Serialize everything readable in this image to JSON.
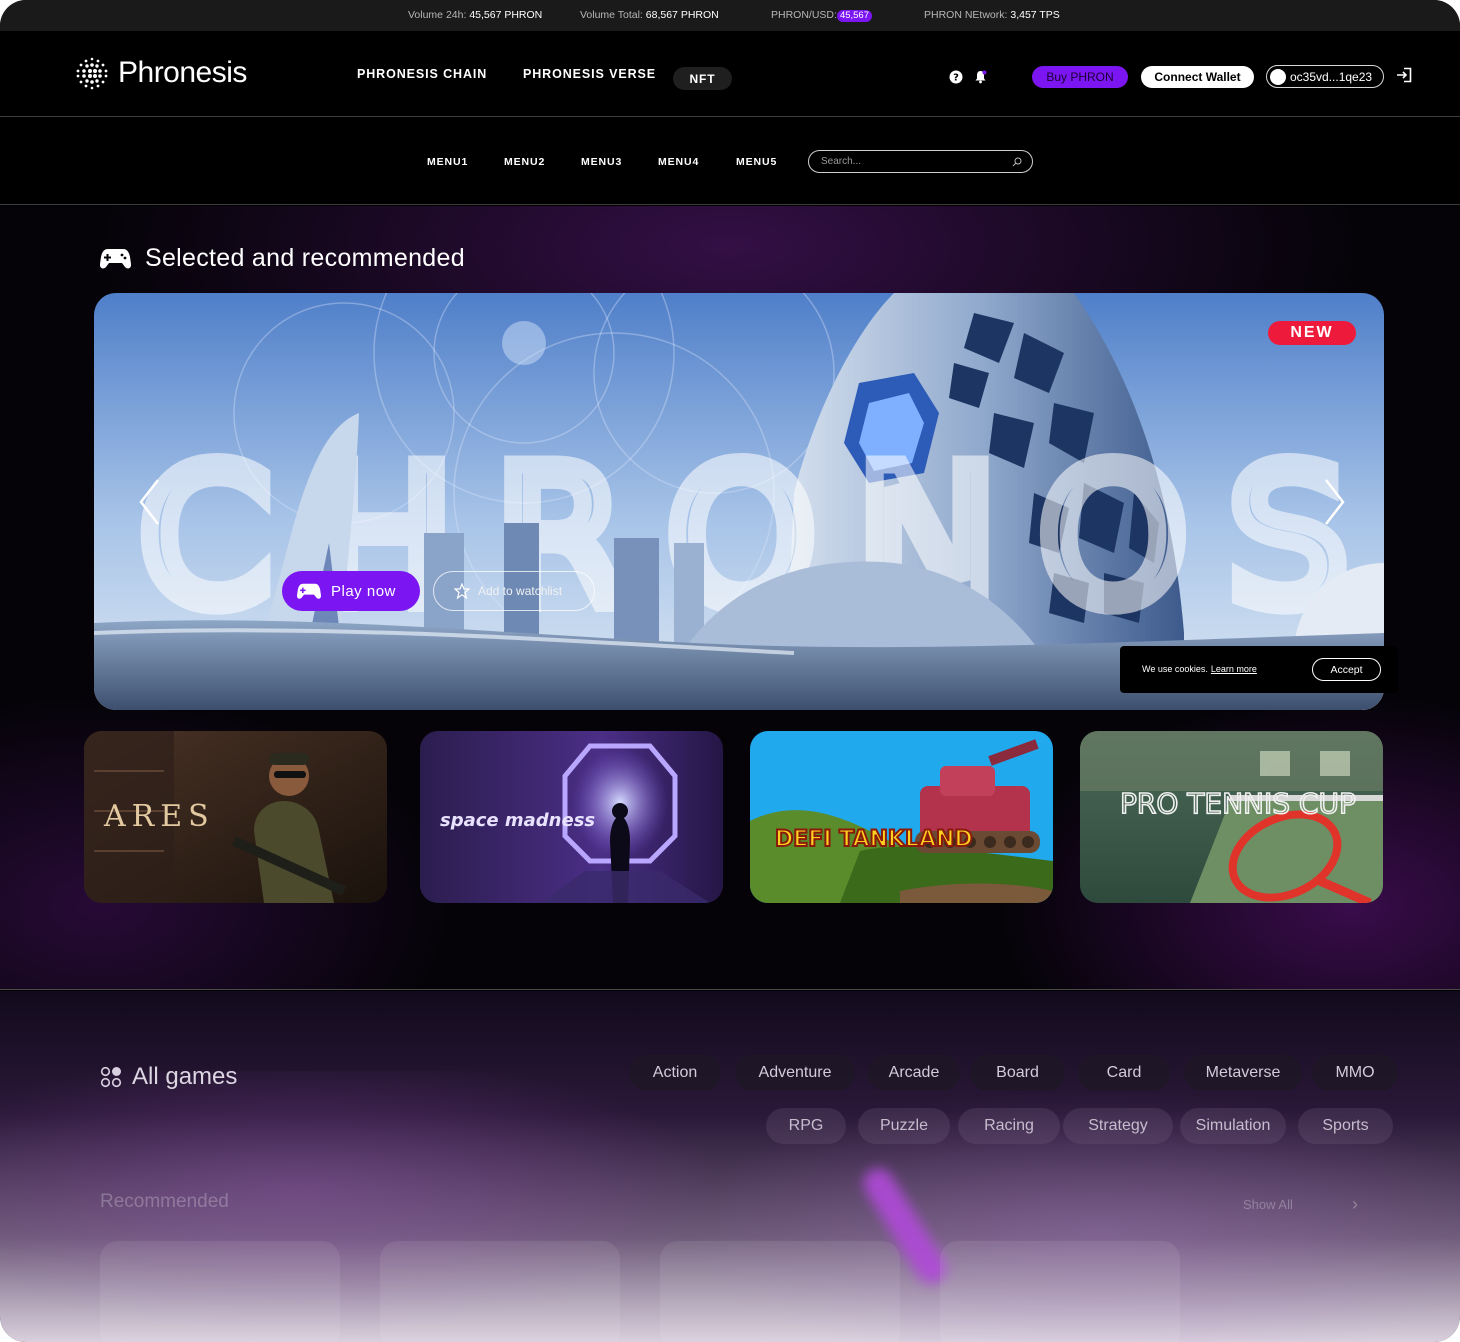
{
  "ticker": {
    "volume24h_label": "Volume 24h:",
    "volume24h_value": "45,567 PHRON",
    "volume_total_label": "Volume Total:",
    "volume_total_value": "68,567 PHRON",
    "price_label": "PHRON/USD:",
    "price_value": "45,567",
    "network_label": "PHRON NEtwork:",
    "network_value": "3,457 TPS"
  },
  "header": {
    "logo_text": "Phronesis",
    "nav": [
      "PHRONESIS CHAIN",
      "PHRONESIS VERSE",
      "NFT"
    ],
    "buy_label": "Buy PHRON",
    "connect_label": "Connect Wallet",
    "wallet_address": "oc35vd...1qe23"
  },
  "subnav": {
    "menus": [
      "MENU1",
      "MENU2",
      "MENU3",
      "MENU4",
      "MENU5"
    ],
    "search_placeholder": "Search..."
  },
  "featured": {
    "title": "Selected and recommended",
    "badge": "NEW",
    "hero_wordmark": "CHRONOS",
    "play_label": "Play now",
    "watchlist_label": "Add to watchlist",
    "games": [
      {
        "title": "ARES"
      },
      {
        "title": "space madness"
      },
      {
        "title": "DEFI TANKLAND"
      },
      {
        "title": "PRO TENNIS CUP"
      }
    ]
  },
  "cookie": {
    "text": "We use cookies.",
    "link": "Learn more",
    "accept": "Accept"
  },
  "all_games": {
    "title": "All games",
    "categories_row1": [
      "Action",
      "Adventure",
      "Arcade",
      "Board",
      "Card",
      "Metaverse",
      "MMO"
    ],
    "categories_row2": [
      "RPG",
      "Puzzle",
      "Racing",
      "Strategy",
      "Simulation",
      "Sports"
    ],
    "recommended_title": "Recommended",
    "show_all": "Show All"
  },
  "colors": {
    "accent": "#7b16f2",
    "badge": "#ee1a3b",
    "background": "#000000"
  }
}
